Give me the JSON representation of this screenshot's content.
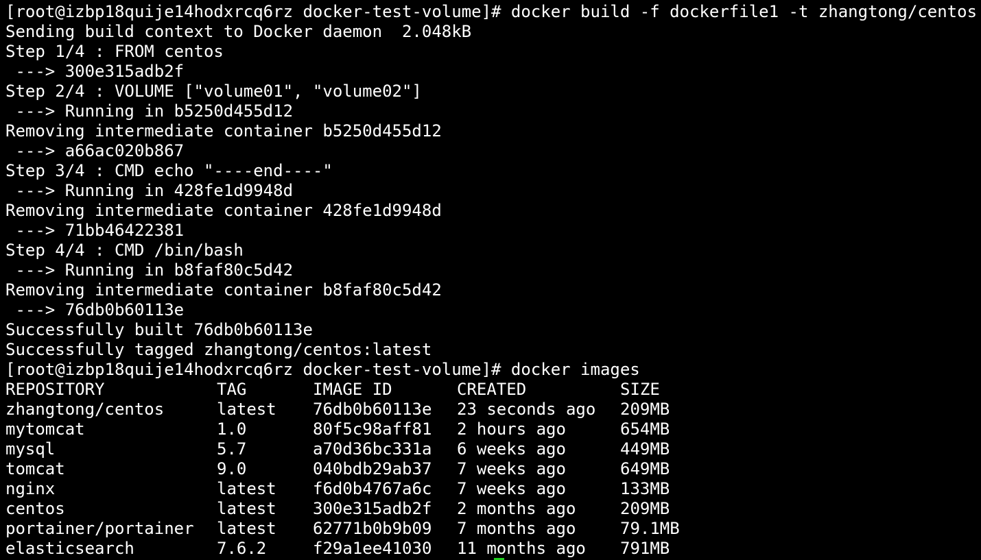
{
  "theme": {
    "background": "#000000",
    "foreground": "#ffffff",
    "cursor": "#1fd01f"
  },
  "lines": [
    "[root@izbp18quije14hodxrcq6rz docker-test-volume]# docker build -f dockerfile1 -t zhangtong/centos .",
    "Sending build context to Docker daemon  2.048kB",
    "Step 1/4 : FROM centos",
    " ---> 300e315adb2f",
    "Step 2/4 : VOLUME [\"volume01\", \"volume02\"]",
    " ---> Running in b5250d455d12",
    "Removing intermediate container b5250d455d12",
    " ---> a66ac020b867",
    "Step 3/4 : CMD echo \"----end----\"",
    " ---> Running in 428fe1d9948d",
    "Removing intermediate container 428fe1d9948d",
    " ---> 71bb46422381",
    "Step 4/4 : CMD /bin/bash",
    " ---> Running in b8faf80c5d42",
    "Removing intermediate container b8faf80c5d42",
    " ---> 76db0b60113e",
    "Successfully built 76db0b60113e",
    "Successfully tagged zhangtong/centos:latest",
    "[root@izbp18quije14hodxrcq6rz docker-test-volume]# docker images"
  ],
  "images_table": {
    "headers": {
      "repository": "REPOSITORY",
      "tag": "TAG",
      "image_id": "IMAGE ID",
      "created": "CREATED",
      "size": "SIZE"
    },
    "rows": [
      {
        "repository": "zhangtong/centos",
        "tag": "latest",
        "image_id": "76db0b60113e",
        "created": "23 seconds ago",
        "size": "209MB"
      },
      {
        "repository": "mytomcat",
        "tag": "1.0",
        "image_id": "80f5c98aff81",
        "created": "2 hours ago",
        "size": "654MB"
      },
      {
        "repository": "mysql",
        "tag": "5.7",
        "image_id": "a70d36bc331a",
        "created": "6 weeks ago",
        "size": "449MB"
      },
      {
        "repository": "tomcat",
        "tag": "9.0",
        "image_id": "040bdb29ab37",
        "created": "7 weeks ago",
        "size": "649MB"
      },
      {
        "repository": "nginx",
        "tag": "latest",
        "image_id": "f6d0b4767a6c",
        "created": "7 weeks ago",
        "size": "133MB"
      },
      {
        "repository": "centos",
        "tag": "latest",
        "image_id": "300e315adb2f",
        "created": "2 months ago",
        "size": "209MB"
      },
      {
        "repository": "portainer/portainer",
        "tag": "latest",
        "image_id": "62771b0b9b09",
        "created": "7 months ago",
        "size": "79.1MB"
      },
      {
        "repository": "elasticsearch",
        "tag": "7.6.2",
        "image_id": "f29a1ee41030",
        "created": "11 months ago",
        "size": "791MB"
      }
    ]
  }
}
